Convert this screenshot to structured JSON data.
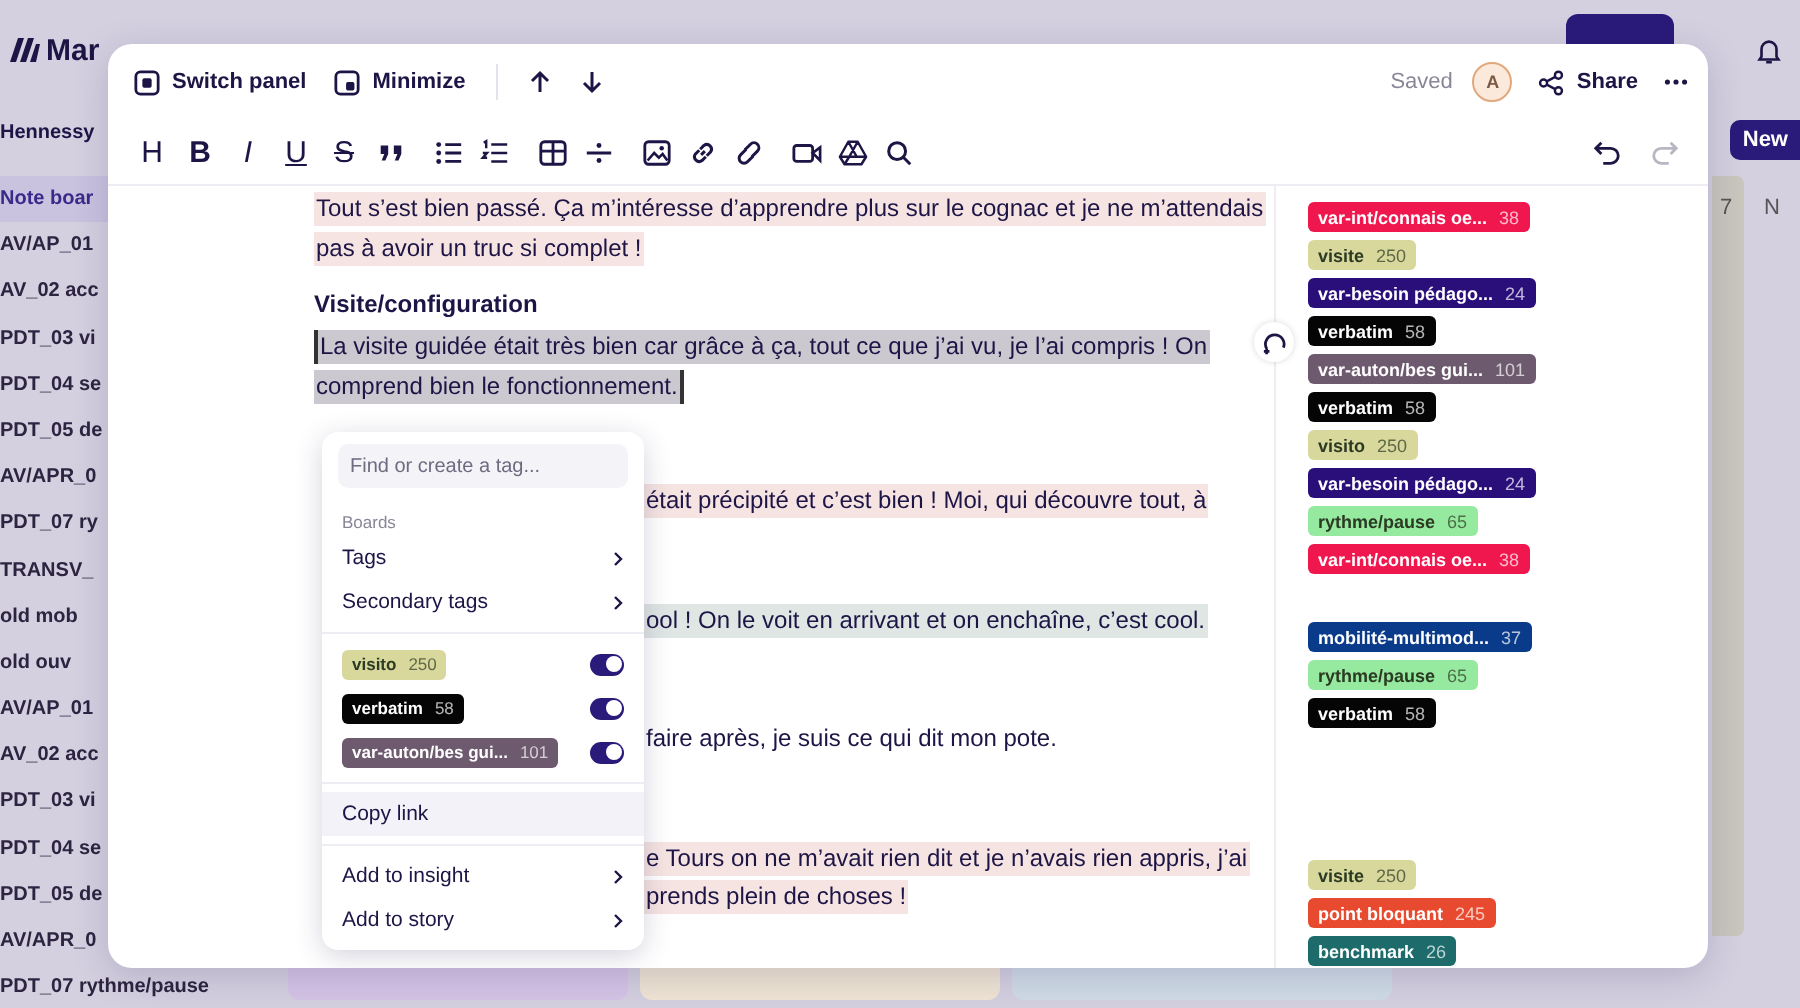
{
  "app": {
    "logo_text": "Mar",
    "sidebar_header": "Hennessy",
    "new_button": "New",
    "column_label": "7",
    "column_label_2": "N",
    "sidebar": [
      {
        "label": "Note boar",
        "selected": true
      },
      {
        "label": "AV/AP_01",
        "selected": false
      },
      {
        "label": "AV_02 acc",
        "selected": false
      },
      {
        "label": "PDT_03 vi",
        "selected": false
      },
      {
        "label": "PDT_04 se",
        "selected": false
      },
      {
        "label": "PDT_05 de",
        "selected": false
      },
      {
        "label": "AV/APR_0",
        "selected": false
      },
      {
        "label": "PDT_07 ry",
        "selected": false
      },
      {
        "label": "TRANSV_",
        "selected": false
      },
      {
        "label": "old mob",
        "selected": false
      },
      {
        "label": "old ouv",
        "selected": false
      },
      {
        "label": "AV/AP_01",
        "selected": false
      },
      {
        "label": "AV_02 acc",
        "selected": false
      },
      {
        "label": "PDT_03 vi",
        "selected": false
      },
      {
        "label": "PDT_04 se",
        "selected": false
      },
      {
        "label": "PDT_05 de",
        "selected": false
      },
      {
        "label": "AV/APR_0",
        "selected": false
      },
      {
        "label": "PDT_07 rythme/pause",
        "selected": false
      }
    ]
  },
  "panel": {
    "header": {
      "switch": "Switch panel",
      "minimize": "Minimize",
      "status": "Saved",
      "avatar": "A",
      "share": "Share"
    },
    "toolbar": [
      {
        "kind": "heading",
        "label": "H"
      },
      {
        "kind": "bold",
        "label": "B"
      },
      {
        "kind": "italic",
        "label": "I"
      },
      {
        "kind": "underline",
        "label": "U"
      },
      {
        "kind": "strike",
        "label": "S"
      },
      {
        "kind": "quote"
      },
      {
        "kind": "bullets"
      },
      {
        "kind": "numbers"
      },
      {
        "kind": "table"
      },
      {
        "kind": "rule"
      },
      {
        "kind": "image"
      },
      {
        "kind": "link"
      },
      {
        "kind": "unlink"
      },
      {
        "kind": "video"
      },
      {
        "kind": "drive"
      },
      {
        "kind": "find"
      }
    ],
    "history": [
      {
        "kind": "undo",
        "disabled": false
      },
      {
        "kind": "redo",
        "disabled": true
      }
    ],
    "document": [
      {
        "kind": "para",
        "selected": false,
        "color": "#f6e4e2",
        "lines": [
          {
            "text": "Tout s’est bien passé. Ça m’intéresse d’apprendre plus sur le cognac et je ne m’attendais"
          },
          {
            "text": "pas à avoir un truc si complet !"
          }
        ]
      },
      {
        "kind": "heading",
        "lines": [
          {
            "text": "Visite/configuration"
          }
        ]
      },
      {
        "kind": "para",
        "selected": true,
        "lines": [
          {
            "text": "La visite guidée était très bien car grâce à ça, tout ce que j’ai vu, je l’ai compris ! On"
          },
          {
            "text": "comprend bien le fonctionnement."
          }
        ]
      },
      {
        "kind": "para",
        "selected": false,
        "covered": true,
        "color": "#f6e4e2",
        "lines": [
          {
            "text": "était précipité et c’est bien ! Moi, qui découvre tout, à"
          }
        ]
      },
      {
        "kind": "para",
        "selected": false,
        "covered": true,
        "color": "#dfe6e4",
        "lines": [
          {
            "text": "ool ! On le voit en arrivant et on enchaîne, c’est cool."
          }
        ]
      },
      {
        "kind": "para",
        "selected": false,
        "covered": true,
        "color": "#ffffff",
        "lines": [
          {
            "text": "faire après, je suis ce qui dit mon pote."
          }
        ]
      },
      {
        "kind": "para",
        "selected": false,
        "covered": true,
        "color": "#f6e4e2",
        "lines": [
          {
            "text": "e Tours on ne m’avait rien dit et je n’avais rien appris, j’ai"
          },
          {
            "text": "prends plein de choses !"
          }
        ]
      }
    ],
    "tag_groups": [
      [
        {
          "name": "var-int/connais oe...",
          "count": "38",
          "color": "#f0174f"
        },
        {
          "name": "visite",
          "count": "250",
          "color": "#d8d79c"
        },
        {
          "name": "var-besoin pédago...",
          "count": "24",
          "color": "#2a0f7a"
        },
        {
          "name": "verbatim",
          "count": "58",
          "color": "#050505"
        },
        {
          "name": "var-auton/bes gui...",
          "count": "101",
          "color": "#6e5a6e"
        },
        {
          "name": "verbatim",
          "count": "58",
          "color": "#050505"
        },
        {
          "name": "visito",
          "count": "250",
          "color": "#d8d79c"
        },
        {
          "name": "var-besoin pédago...",
          "count": "24",
          "color": "#2a0f7a"
        },
        {
          "name": "rythme/pause",
          "count": "65",
          "color": "#96eaa0"
        },
        {
          "name": "var-int/connais oe...",
          "count": "38",
          "color": "#f0174f"
        }
      ],
      [
        {
          "name": "mobilité-multimod...",
          "count": "37",
          "color": "#0a3a8a"
        },
        {
          "name": "rythme/pause",
          "count": "65",
          "color": "#96eaa0"
        },
        {
          "name": "verbatim",
          "count": "58",
          "color": "#050505"
        }
      ],
      [
        {
          "name": "visite",
          "count": "250",
          "color": "#d8d79c"
        },
        {
          "name": "point bloquant",
          "count": "245",
          "color": "#e84a2f"
        },
        {
          "name": "benchmark",
          "count": "26",
          "color": "#1d6b6b"
        }
      ]
    ],
    "menu": {
      "placeholder": "Find or create a tag...",
      "section": "Boards",
      "submenus": [
        {
          "label": "Tags"
        },
        {
          "label": "Secondary tags"
        }
      ],
      "tags": [
        {
          "name": "visito",
          "count": "250",
          "color": "#d8d79c",
          "on": true
        },
        {
          "name": "verbatim",
          "count": "58",
          "color": "#050505",
          "on": true
        },
        {
          "name": "var-auton/bes gui...",
          "count": "101",
          "color": "#6e5a6e",
          "on": true
        }
      ],
      "actions": [
        {
          "label": "Copy link",
          "highlighted": true
        }
      ],
      "more": [
        {
          "label": "Add to insight",
          "highlighted": false
        },
        {
          "label": "Add to story",
          "highlighted": false
        }
      ]
    }
  }
}
